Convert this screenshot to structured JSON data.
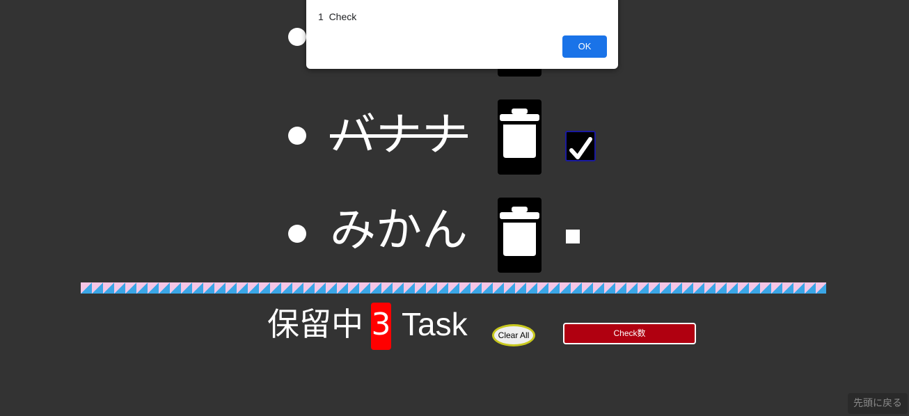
{
  "dialog": {
    "title": "",
    "message": "1  Check",
    "ok_label": "OK"
  },
  "tasks": [
    {
      "label": "",
      "done": false,
      "checked": false
    },
    {
      "label": "バナナ",
      "done": true,
      "checked": true
    },
    {
      "label": "みかん",
      "done": false,
      "checked": false
    }
  ],
  "footer": {
    "status_label": "保留中",
    "count": "3",
    "task_word": "Task",
    "clear_all_label": "Clear All",
    "check_count_label": "Check数",
    "back_to_top_label": "先頭に戻る"
  },
  "icons": {
    "trash": "trash-icon",
    "check": "checkmark-icon"
  },
  "colors": {
    "background": "#333333",
    "badge": "#ff0000",
    "check_button": "#b00010",
    "divider_pink": "#f5c6e6",
    "divider_blue": "#3ba6e6",
    "ok_button": "#1a73e8"
  }
}
